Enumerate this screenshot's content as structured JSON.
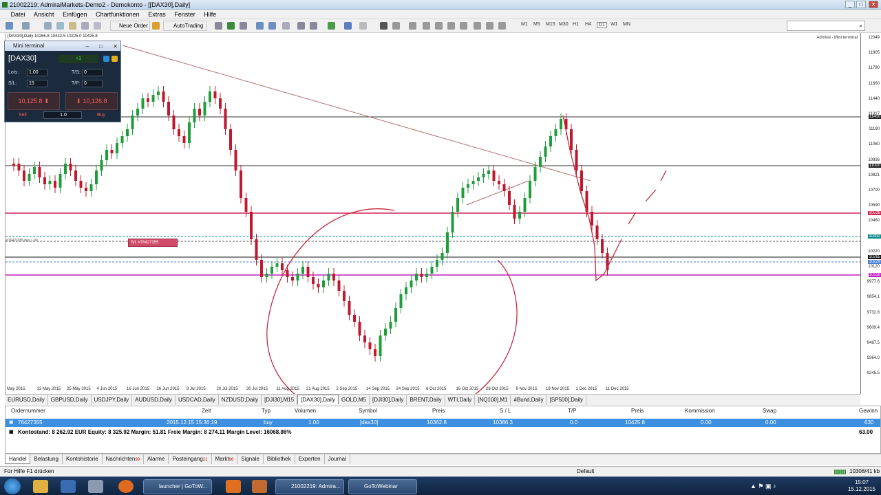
{
  "window": {
    "title": "21002219: AdmiralMarkets-Demo2 - Demokonto - [[DAX30],Daily]"
  },
  "menu": [
    "Datei",
    "Ansicht",
    "Einfügen",
    "Chartfunktionen",
    "Extras",
    "Fenster",
    "Hilfe"
  ],
  "toolbar": {
    "new_order": "Neue Order",
    "autotrading": "AutoTrading",
    "timeframes": [
      "M1",
      "M5",
      "M15",
      "M30",
      "H1",
      "H4",
      "D1",
      "W1",
      "MN"
    ]
  },
  "chart": {
    "header": "[DAX30],Daily  10266.8 10432.5 10225.0 10425.8",
    "corner": "Admiral - Mini terminal",
    "y_labels": [
      "12049",
      "11905",
      "11790",
      "11660",
      "11440",
      "11317",
      "11190",
      "11060",
      "10936",
      "10821",
      "10700",
      "10590",
      "10460",
      "10341",
      "10220",
      "10120",
      "9977.6",
      "9854.1",
      "9732.8",
      "9609.4",
      "9487.5",
      "9364.0",
      "9245.5"
    ],
    "y_tags": [
      {
        "text": "11400",
        "color": "#222"
      },
      {
        "text": "11000",
        "color": "#222"
      },
      {
        "text": "10538",
        "color": "#d02050"
      },
      {
        "text": "10432",
        "color": "#0a8a8a"
      },
      {
        "text": "10265",
        "color": "#111"
      },
      {
        "text": "10229",
        "color": "#4a7dd4"
      },
      {
        "text": "10118",
        "color": "#c020c0"
      }
    ],
    "x_labels": [
      "May 2015",
      "13 May 2015",
      "25 May 2015",
      "4 Jun 2015",
      "16 Jun 2015",
      "26 Jun 2015",
      "8 Jul 2015",
      "20 Jul 2015",
      "30 Jul 2015",
      "11 Aug 2015",
      "21 Aug 2015",
      "2 Sep 2015",
      "14 Sep 2015",
      "24 Sep 2015",
      "6 Oct 2015",
      "16 Oct 2015",
      "28 Oct 2015",
      "9 Nov 2015",
      "19 Nov 2015",
      "1 Dec 2015",
      "11 Dec 2015"
    ],
    "order_label": "#76427355 buy 1.00",
    "sl_label": "S/L #76427355"
  },
  "mini_terminal": {
    "title": "Mini terminal",
    "symbol": "[DAX30]",
    "change": "+1",
    "lots_label": "Lots:",
    "lots": "1.00",
    "ts_label": "T/S:",
    "ts": "0",
    "sl_label": "S/L:",
    "sl": "15",
    "tp_label": "T/P:",
    "tp": "0",
    "sell_price": "10,125.8",
    "buy_price": "10,126.8",
    "sell": "Sell",
    "buy": "Buy",
    "qty": "1.0"
  },
  "chart_tabs": [
    "EURUSD,Daily",
    "GBPUSD,Daily",
    "USDJPY,Daily",
    "AUDUSD,Daily",
    "USDCAD,Daily",
    "NZDUSD,Daily",
    "[DJI30],M15",
    "[DAX30],Daily",
    "GOLD,M5",
    "[DJI30],Daily",
    "BRENT,Daily",
    "WTI,Daily",
    "[NQ100],M1",
    "#Bund,Daily",
    "[SP500],Daily"
  ],
  "active_chart_tab": "[DAX30],Daily",
  "terminal": {
    "headers": [
      "Ordernummer",
      "Zeit",
      "Typ",
      "Volumen",
      "Symbol",
      "Preis",
      "S / L",
      "T/P",
      "Preis",
      "Kommission",
      "Swap",
      "Gewinn"
    ],
    "row": [
      "76427355",
      "2015.12.15 15:36:19",
      "buy",
      "1.00",
      "[dax30]",
      "10362.8",
      "10386.3",
      "0.0",
      "10425.8",
      "0.00",
      "0.00",
      "630"
    ],
    "balance": "Kontostand: 8 262.92 EUR  Equity: 8 325.92  Margin: 51.81  Freie Margin: 8 274.11  Margin Level: 16068.86%",
    "balance_profit": "63.00"
  },
  "terminal_tabs": [
    {
      "label": "Handel"
    },
    {
      "label": "Belastung"
    },
    {
      "label": "Kontohistorie"
    },
    {
      "label": "Nachrichten",
      "badge": "99"
    },
    {
      "label": "Alarme"
    },
    {
      "label": "Posteingang",
      "badge": "21"
    },
    {
      "label": "Markt",
      "badge": "66"
    },
    {
      "label": "Signale"
    },
    {
      "label": "Bibliothek"
    },
    {
      "label": "Experten"
    },
    {
      "label": "Journal"
    }
  ],
  "status": {
    "help": "Für Hilfe F1 drücken",
    "profile": "Default",
    "traffic": "10308/41 kb"
  },
  "taskbar": {
    "items": [
      "launcher | GoToW...",
      "21002219: Admira...",
      "GoToWebinar"
    ],
    "time": "15:07",
    "date": "15.12.2015"
  },
  "colors": {
    "bull": "#1e9e3a",
    "bear": "#c0182c",
    "resistance": "#d02050",
    "support": "#c020c0",
    "drawing": "#c8283c"
  }
}
